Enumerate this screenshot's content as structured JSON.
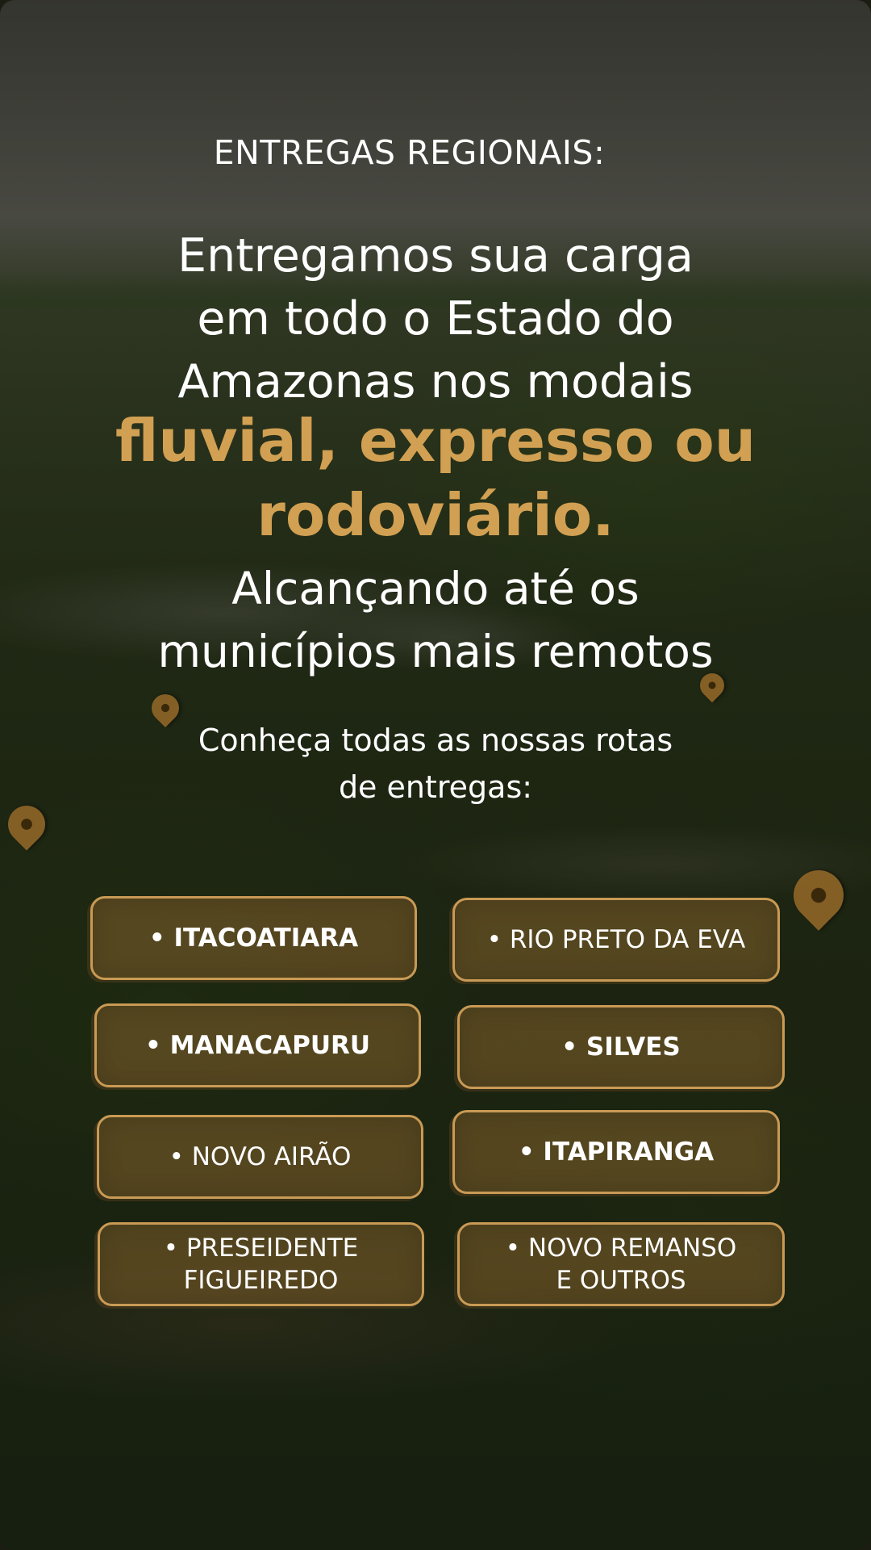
{
  "eyebrow": "ENTREGAS REGIONAIS:",
  "headline": {
    "line1": "Entregamos sua carga",
    "line2": "em todo o Estado do",
    "line3": "Amazonas nos modais"
  },
  "highlight": {
    "line1": "fluvial, expresso ou",
    "line2": "rodoviário."
  },
  "subline": {
    "line1": "Alcançando até os",
    "line2": "municípios mais remotos"
  },
  "routes_intro": {
    "line1": "Conheça todas as nossas rotas",
    "line2": "de entregas:"
  },
  "routes": {
    "itacoatiara": "• ITACOATIARA",
    "rio_preto_da_eva": "• RIO PRETO DA EVA",
    "manacapuru": "• MANACAPURU",
    "silves": "• SILVES",
    "novo_airao": "• NOVO AIRÃO",
    "itapiranga": "• ITAPIRANGA",
    "presidente_figueiredo_line1": "• PRESEIDENTE",
    "presidente_figueiredo_line2": "FIGUEIREDO",
    "novo_remanso_line1": "• NOVO REMANSO",
    "novo_remanso_line2": "E OUTROS"
  },
  "colors": {
    "accent_gold": "#d1a052",
    "button_border": "#c99a55",
    "button_fill": "#7a5a28"
  },
  "icons": [
    "map-pin-icon"
  ]
}
